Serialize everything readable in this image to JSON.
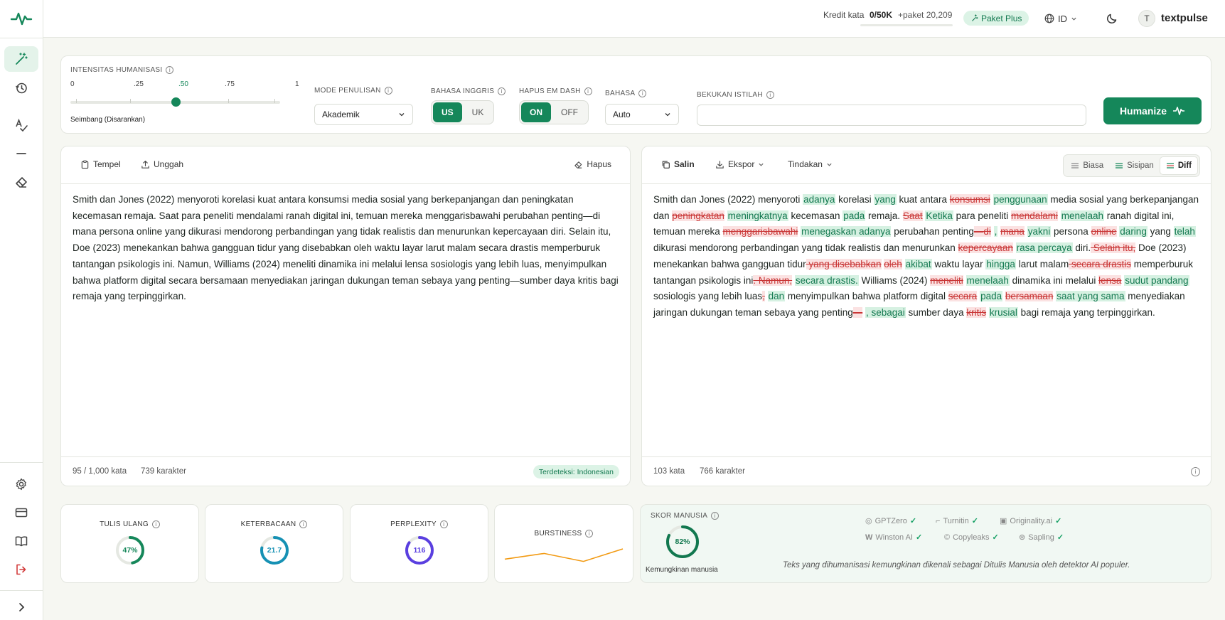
{
  "sidebar": {
    "logo_icon": "pulse-icon",
    "items": [
      {
        "icon": "magic-wand-icon",
        "active": true
      },
      {
        "icon": "history-icon",
        "active": false
      },
      {
        "icon": "spell-check-icon",
        "active": false
      },
      {
        "icon": "em-dash-icon",
        "active": false
      },
      {
        "icon": "eraser-icon",
        "active": false
      }
    ],
    "bottom_items": [
      {
        "icon": "gear-icon"
      },
      {
        "icon": "credit-card-icon"
      },
      {
        "icon": "book-icon"
      },
      {
        "icon": "logout-icon"
      }
    ],
    "expand_icon": "chevron-right-icon"
  },
  "topbar": {
    "credit_label": "Kredit kata",
    "credit_value": "0/50K",
    "credit_used_fraction": 0,
    "credit_paket": "+paket 20,209",
    "plan_badge": "Paket Plus",
    "language": "ID",
    "avatar_initial": "T",
    "username": "textpulse"
  },
  "settings": {
    "intensity_label": "INTENSITAS HUMANISASI",
    "intensity_ticks": [
      "0",
      ".25",
      ".50",
      ".75",
      "1"
    ],
    "intensity_value": 0.5,
    "intensity_caption": "Seimbang (Disarankan)",
    "mode_label": "MODE PENULISAN",
    "mode_value": "Akademik",
    "english_label": "BAHASA INGGRIS",
    "english_options": [
      "US",
      "UK"
    ],
    "english_selected": "US",
    "emdash_label": "HAPUS EM DASH",
    "emdash_options": [
      "ON",
      "OFF"
    ],
    "emdash_selected": "ON",
    "language_label": "BAHASA",
    "language_value": "Auto",
    "freeze_label": "BEKUKAN ISTILAH",
    "freeze_value": "",
    "humanize_button": "Humanize"
  },
  "input_panel": {
    "paste_label": "Tempel",
    "upload_label": "Unggah",
    "clear_label": "Hapus",
    "text": "Smith dan Jones (2022) menyoroti korelasi kuat antara konsumsi media sosial yang berkepanjangan dan peningkatan kecemasan remaja. Saat para peneliti mendalami ranah digital ini, temuan mereka menggarisbawahi perubahan penting—di mana persona online yang dikurasi mendorong perbandingan yang tidak realistis dan menurunkan kepercayaan diri. Selain itu, Doe (2023) menekankan bahwa gangguan tidur yang disebabkan oleh waktu layar larut malam secara drastis memperburuk tantangan psikologis ini. Namun, Williams (2024) meneliti dinamika ini melalui lensa sosiologis yang lebih luas, menyimpulkan bahwa platform digital secara bersamaan menyediakan jaringan dukungan teman sebaya yang penting—sumber daya kritis bagi remaja yang terpinggirkan.",
    "word_count": "95 / 1,000 kata",
    "char_count": "739 karakter",
    "detected": "Terdeteksi: Indonesian"
  },
  "output_panel": {
    "copy_label": "Salin",
    "export_label": "Ekspor",
    "actions_label": "Tindakan",
    "view_options": [
      "Biasa",
      "Sisipan",
      "Diff"
    ],
    "view_selected": "Diff",
    "word_count": "103 kata",
    "char_count": "766 karakter",
    "diff": [
      {
        "t": "Smith dan Jones (2022) menyoroti "
      },
      {
        "t": "adanya",
        "k": "ins"
      },
      {
        "t": " korelasi "
      },
      {
        "t": "yang",
        "k": "ins"
      },
      {
        "t": " kuat antara "
      },
      {
        "t": "konsumsi",
        "k": "del"
      },
      {
        "t": " "
      },
      {
        "t": "penggunaan",
        "k": "ins"
      },
      {
        "t": " media sosial yang berkepanjangan dan "
      },
      {
        "t": "peningkatan",
        "k": "del"
      },
      {
        "t": " "
      },
      {
        "t": "meningkatnya",
        "k": "ins"
      },
      {
        "t": " kecemasan "
      },
      {
        "t": "pada",
        "k": "ins"
      },
      {
        "t": " remaja. "
      },
      {
        "t": "Saat",
        "k": "del"
      },
      {
        "t": " "
      },
      {
        "t": "Ketika",
        "k": "ins"
      },
      {
        "t": " para peneliti "
      },
      {
        "t": "mendalami",
        "k": "del"
      },
      {
        "t": " "
      },
      {
        "t": "menelaah",
        "k": "ins"
      },
      {
        "t": " ranah digital ini, temuan mereka "
      },
      {
        "t": "menggarisbawahi",
        "k": "del"
      },
      {
        "t": " "
      },
      {
        "t": "menegaskan adanya",
        "k": "ins"
      },
      {
        "t": " perubahan penting"
      },
      {
        "t": "—di",
        "k": "del"
      },
      {
        "t": " "
      },
      {
        "t": ",",
        "k": "ins"
      },
      {
        "t": " "
      },
      {
        "t": "mana",
        "k": "del"
      },
      {
        "t": " "
      },
      {
        "t": "yakni",
        "k": "ins"
      },
      {
        "t": " persona "
      },
      {
        "t": "online",
        "k": "del"
      },
      {
        "t": " "
      },
      {
        "t": "daring",
        "k": "ins"
      },
      {
        "t": " yang "
      },
      {
        "t": "telah",
        "k": "ins"
      },
      {
        "t": " dikurasi mendorong perbandingan yang tidak realistis dan menurunkan "
      },
      {
        "t": "kepercayaan",
        "k": "del"
      },
      {
        "t": " "
      },
      {
        "t": "rasa percaya",
        "k": "ins"
      },
      {
        "t": " diri."
      },
      {
        "t": " Selain itu,",
        "k": "del"
      },
      {
        "t": " Doe (2023) menekankan bahwa gangguan tidur"
      },
      {
        "t": " yang disebabkan",
        "k": "del"
      },
      {
        "t": " "
      },
      {
        "t": "oleh",
        "k": "del"
      },
      {
        "t": " "
      },
      {
        "t": "akibat",
        "k": "ins"
      },
      {
        "t": " waktu layar "
      },
      {
        "t": "hingga",
        "k": "ins"
      },
      {
        "t": " larut malam"
      },
      {
        "t": " secara drastis",
        "k": "del"
      },
      {
        "t": " memperburuk tantangan psikologis ini"
      },
      {
        "t": ". Namun,",
        "k": "del"
      },
      {
        "t": " "
      },
      {
        "t": "secara drastis.",
        "k": "ins"
      },
      {
        "t": " Williams (2024) "
      },
      {
        "t": "meneliti",
        "k": "del"
      },
      {
        "t": " "
      },
      {
        "t": "menelaah",
        "k": "ins"
      },
      {
        "t": " dinamika ini melalui "
      },
      {
        "t": "lensa",
        "k": "del"
      },
      {
        "t": " "
      },
      {
        "t": "sudut pandang",
        "k": "ins"
      },
      {
        "t": " sosiologis yang lebih luas"
      },
      {
        "t": ",",
        "k": "del"
      },
      {
        "t": " "
      },
      {
        "t": "dan",
        "k": "ins"
      },
      {
        "t": " menyimpulkan bahwa platform digital "
      },
      {
        "t": "secara",
        "k": "del"
      },
      {
        "t": " "
      },
      {
        "t": "pada",
        "k": "ins"
      },
      {
        "t": " "
      },
      {
        "t": "bersamaan",
        "k": "del"
      },
      {
        "t": " "
      },
      {
        "t": "saat yang sama",
        "k": "ins"
      },
      {
        "t": " menyediakan jaringan dukungan teman sebaya yang penting"
      },
      {
        "t": "—",
        "k": "del"
      },
      {
        "t": " "
      },
      {
        "t": ", sebagai",
        "k": "ins"
      },
      {
        "t": " sumber daya "
      },
      {
        "t": "kritis",
        "k": "del"
      },
      {
        "t": " "
      },
      {
        "t": "krusial",
        "k": "ins"
      },
      {
        "t": " bagi remaja yang terpinggirkan."
      }
    ]
  },
  "metrics": {
    "rewrite": {
      "label": "TULIS ULANG",
      "value": "47%",
      "fraction": 0.47,
      "color": "#15875a"
    },
    "readability": {
      "label": "KETERBACAAN",
      "value": "21.7",
      "fraction": 0.78,
      "color": "#1691b4"
    },
    "perplexity": {
      "label": "PERPLEXITY",
      "value": "116",
      "fraction": 0.85,
      "color": "#5a3fe0"
    },
    "burstiness": {
      "label": "BURSTINESS",
      "points": [
        0.3,
        0.55,
        0.2,
        0.75
      ],
      "color": "#f29a12"
    }
  },
  "human_score": {
    "label": "SKOR MANUSIA",
    "value": "82%",
    "fraction": 0.82,
    "caption": "Kemungkinan manusia",
    "detectors": [
      {
        "name": "GPTZero",
        "icon": "gptzero-icon"
      },
      {
        "name": "Turnitin",
        "icon": "turnitin-icon"
      },
      {
        "name": "Originality.ai",
        "icon": "originality-icon"
      },
      {
        "name": "Winston AI",
        "icon": "winston-icon"
      },
      {
        "name": "Copyleaks",
        "icon": "copyleaks-icon"
      },
      {
        "name": "Sapling",
        "icon": "sapling-icon"
      }
    ],
    "note": "Teks yang dihumanisasi kemungkinan dikenali sebagai Ditulis Manusia oleh detektor AI populer."
  }
}
